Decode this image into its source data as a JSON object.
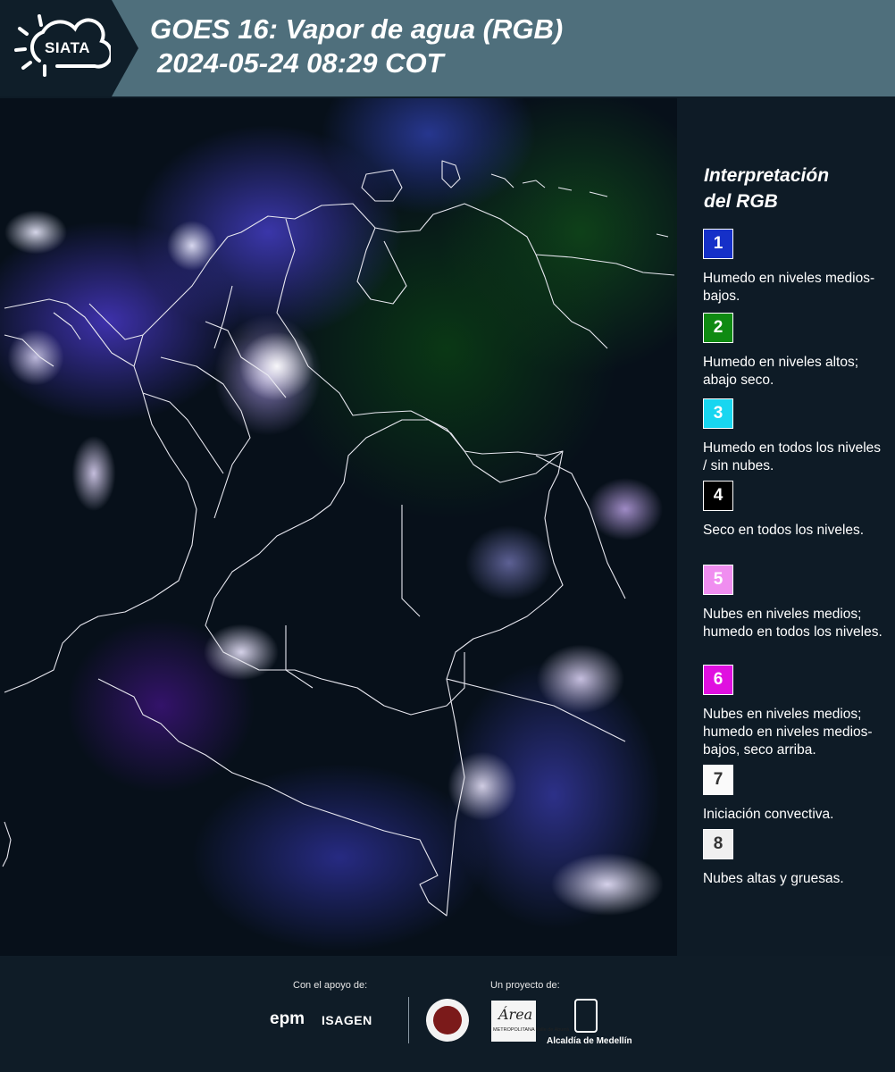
{
  "header": {
    "logo_text": "SIATA",
    "title_line1": "GOES 16: Vapor de agua (RGB)",
    "title_line2": "2024-05-24 08:29 COT"
  },
  "map": {
    "icon": "satellite-map",
    "region": "Colombia"
  },
  "legend": {
    "title_line1": "Interpretación",
    "title_line2": "del RGB",
    "items": [
      {
        "number": "1",
        "color": "#1530c8",
        "text_color": "#ffffff",
        "desc": "Humedo en niveles medios-bajos."
      },
      {
        "number": "2",
        "color": "#0f8a12",
        "text_color": "#ffffff",
        "desc": "Humedo en niveles altos; abajo seco."
      },
      {
        "number": "3",
        "color": "#18d6f0",
        "text_color": "#ffffff",
        "desc": "Humedo en todos los niveles / sin nubes."
      },
      {
        "number": "4",
        "color": "#000000",
        "text_color": "#ffffff",
        "desc": "Seco en todos los niveles."
      },
      {
        "number": "5",
        "color": "#f08ef0",
        "text_color": "#ffffff",
        "desc": "Nubes en niveles medios; humedo en todos los niveles."
      },
      {
        "number": "6",
        "color": "#e010e0",
        "text_color": "#ffffff",
        "desc": "Nubes en niveles medios; humedo en niveles medios-bajos, seco arriba."
      },
      {
        "number": "7",
        "color": "#fafafa",
        "text_color": "#333333",
        "desc": "Iniciación convectiva."
      },
      {
        "number": "8",
        "color": "#f0f0f0",
        "text_color": "#333333",
        "desc": "Nubes altas y gruesas."
      }
    ]
  },
  "footer": {
    "support_label": "Con el apoyo de:",
    "project_label": "Un proyecto de:",
    "epm": "epm",
    "isagen": "ISAGEN",
    "area_logo": "Área",
    "area_sub": "METROPOLITANA Valle de Aburrá",
    "alcaldia": "Alcaldía de Medellín"
  }
}
